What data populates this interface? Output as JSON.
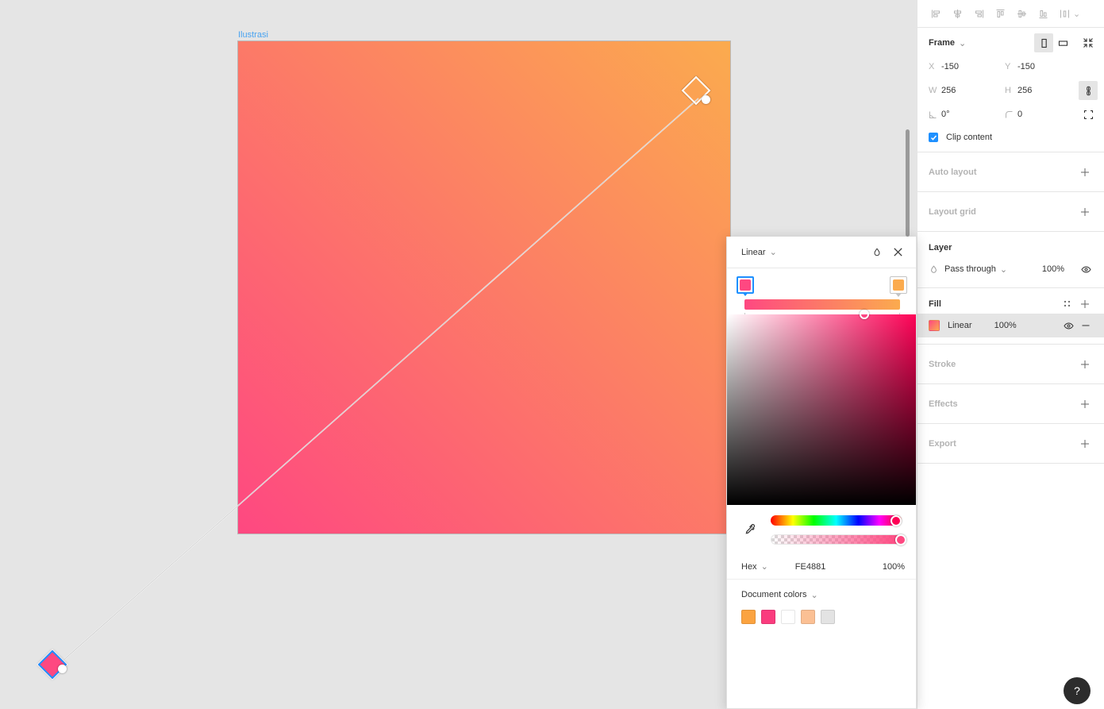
{
  "canvas": {
    "frame_label": "Ilustrasi",
    "gradient": {
      "start_color": "#FE4881",
      "end_color": "#FBAB4E",
      "start_handle_name": "gradient-start-handle",
      "end_handle_name": "gradient-end-handle"
    }
  },
  "align_toolbar": {
    "items": [
      {
        "name": "align-left-icon",
        "label": "Align left"
      },
      {
        "name": "align-horizontal-center-icon",
        "label": "Align horizontal centers"
      },
      {
        "name": "align-right-icon",
        "label": "Align right"
      },
      {
        "name": "align-top-icon",
        "label": "Align top"
      },
      {
        "name": "align-vertical-center-icon",
        "label": "Align vertical centers"
      },
      {
        "name": "align-bottom-icon",
        "label": "Align bottom"
      },
      {
        "name": "distribute-icon",
        "label": "Distribute"
      }
    ],
    "more_chevron": "⌄"
  },
  "frame_section": {
    "title": "Frame",
    "chevron": "⌄",
    "orientation_portrait": "portrait-orientation-icon",
    "orientation_landscape": "landscape-orientation-icon",
    "collapse": "collapse-icon",
    "x_label": "X",
    "x_value": "-150",
    "y_label": "Y",
    "y_value": "-150",
    "w_label": "W",
    "w_value": "256",
    "h_label": "H",
    "h_value": "256",
    "rotation_label": "rotation-icon",
    "rotation_value": "0°",
    "corner_label": "corner-radius-icon",
    "corner_value": "0",
    "clip_content_label": "Clip content",
    "clip_content_checked": true
  },
  "sections": {
    "auto_layout": "Auto layout",
    "layout_grid": "Layout grid",
    "layer": "Layer",
    "fill": "Fill",
    "stroke": "Stroke",
    "effects": "Effects",
    "export": "Export",
    "plus": "+"
  },
  "layer": {
    "blend_mode": "Pass through",
    "chevron": "⌄",
    "opacity": "100%"
  },
  "fill": {
    "type": "Linear",
    "opacity": "100%",
    "swatch_start": "#FE4881",
    "swatch_end": "#FBAB4E"
  },
  "color_picker": {
    "title": "Linear",
    "title_chevron": "⌄",
    "gradient_stops": [
      {
        "color": "#FE4881",
        "position": 0,
        "selected": true
      },
      {
        "color": "#FBAB4E",
        "position": 100,
        "selected": false
      }
    ],
    "sv_cursor": {
      "x_pct": 72,
      "y_pct": 0
    },
    "hue_knob_pct": 96,
    "alpha_knob_pct": 100,
    "hex_mode": "Hex",
    "hex_mode_chevron": "⌄",
    "hex_value": "FE4881",
    "alpha_value": "100%",
    "document_colors_title": "Document colors",
    "document_colors_chevron": "⌄",
    "document_colors": [
      "#F9A council",
      "#FB9C41",
      "#FA3C7E",
      "#FFFFFF",
      "#FBC094",
      "#E3E3E3"
    ],
    "document_swatches": [
      "#FBA340",
      "#FA3C7E",
      "#FFFFFF",
      "#FBC094",
      "#E3E3E3"
    ]
  },
  "help": {
    "label": "?"
  }
}
